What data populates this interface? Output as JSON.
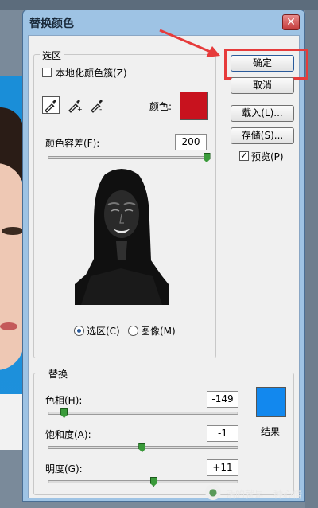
{
  "dialog": {
    "title": "替换颜色",
    "close_label": "✕"
  },
  "buttons": {
    "ok": "确定",
    "cancel": "取消",
    "load": "载入(L)...",
    "save": "存储(S)...",
    "preview": "预览(P)"
  },
  "selection": {
    "legend": "选区",
    "localized_clusters": "本地化颜色簇(Z)",
    "color_label": "颜色:",
    "color_value": "#c8121e",
    "fuzziness_label": "颜色容差(F):",
    "fuzziness_value": "200",
    "fuzziness_fraction": 1.0,
    "radio_selection": "选区(C)",
    "radio_image": "图像(M)"
  },
  "replacement": {
    "legend": "替换",
    "hue_label": "色相(H):",
    "hue_value": "-149",
    "hue_fraction": 0.086,
    "saturation_label": "饱和度(A):",
    "saturation_value": "-1",
    "saturation_fraction": 0.495,
    "lightness_label": "明度(G):",
    "lightness_value": "+11",
    "lightness_fraction": 0.555,
    "result_label": "结果",
    "result_color": "#1288ee"
  },
  "watermark": {
    "text": "活的就是一种心情"
  },
  "icons": [
    "eyedropper-icon",
    "eyedropper-plus-icon",
    "eyedropper-minus-icon",
    "close-icon",
    "wechat-icon"
  ]
}
